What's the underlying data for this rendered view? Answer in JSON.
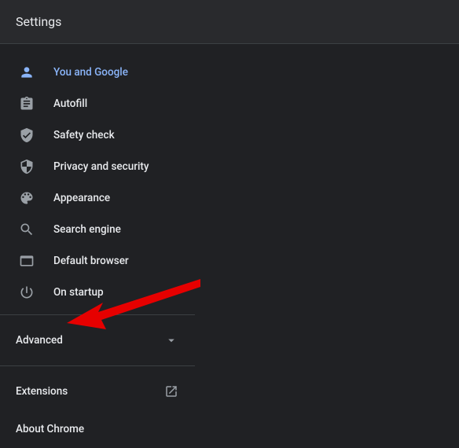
{
  "header": {
    "title": "Settings"
  },
  "sidebar": {
    "items": [
      {
        "label": "You and Google"
      },
      {
        "label": "Autofill"
      },
      {
        "label": "Safety check"
      },
      {
        "label": "Privacy and security"
      },
      {
        "label": "Appearance"
      },
      {
        "label": "Search engine"
      },
      {
        "label": "Default browser"
      },
      {
        "label": "On startup"
      }
    ],
    "advanced_label": "Advanced",
    "extensions_label": "Extensions",
    "about_label": "About Chrome"
  }
}
